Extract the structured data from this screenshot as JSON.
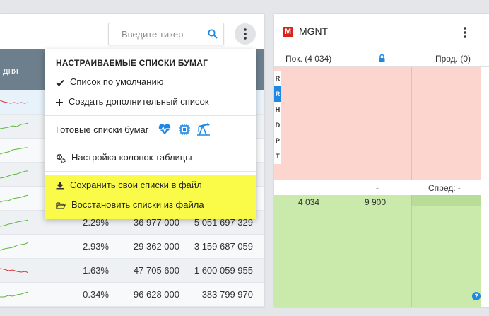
{
  "left": {
    "search_placeholder": "Введите тикер",
    "column_label": "дня",
    "rows": [
      {
        "pct": "",
        "vol": "",
        "turn": "",
        "spark": "red"
      },
      {
        "pct": "",
        "vol": "",
        "turn": "",
        "spark": "green"
      },
      {
        "pct": "",
        "vol": "",
        "turn": "",
        "spark": "green"
      },
      {
        "pct": "",
        "vol": "",
        "turn": "",
        "spark": "green"
      },
      {
        "pct": "",
        "vol": "",
        "turn": "",
        "spark": "green"
      },
      {
        "pct": "2.29%",
        "vol": "36 977 000",
        "turn": "5 051 697 329",
        "spark": "green"
      },
      {
        "pct": "2.93%",
        "vol": "29 362 000",
        "turn": "3 159 687 059",
        "spark": "green"
      },
      {
        "pct": "-1.63%",
        "vol": "47 705 600",
        "turn": "1 600 059 955",
        "spark": "red"
      },
      {
        "pct": "0.34%",
        "vol": "96 628 000",
        "turn": "383 799 970",
        "spark": "green"
      }
    ]
  },
  "menu": {
    "title": "НАСТРАИВАЕМЫЕ СПИСКИ БУМАГ",
    "default_list": "Список по умолчанию",
    "create_list": "Создать дополнительный список",
    "preset_lists": "Готовые списки бумаг",
    "columns_settings": "Настройка колонок таблицы",
    "save_lists": "Сохранить свои списки в файл",
    "restore_lists": "Восстановить списки из файла",
    "icons": [
      "check-icon",
      "plus-icon",
      "heart-pulse-icon",
      "chip-icon",
      "oil-pump-icon",
      "gears-icon",
      "download-icon",
      "folder-open-icon"
    ]
  },
  "orderbook": {
    "ticker": "MGNT",
    "logo_letter": "M",
    "buy_header": "Пок. (4 034)",
    "sell_header": "Прод. (0)",
    "dash": "-",
    "spread": "Спред: -",
    "bid_qty": "4 034",
    "bid_price": "9 900",
    "letters": [
      "R",
      "R",
      "H",
      "D",
      "P",
      "T"
    ],
    "help": "?"
  },
  "colors": {
    "accent": "#1e88e5",
    "ask_bg": "#fcd5cf",
    "bid_bg": "#c9eaab",
    "highlight": "#fafb48",
    "header_bg": "#6d7f8c"
  }
}
